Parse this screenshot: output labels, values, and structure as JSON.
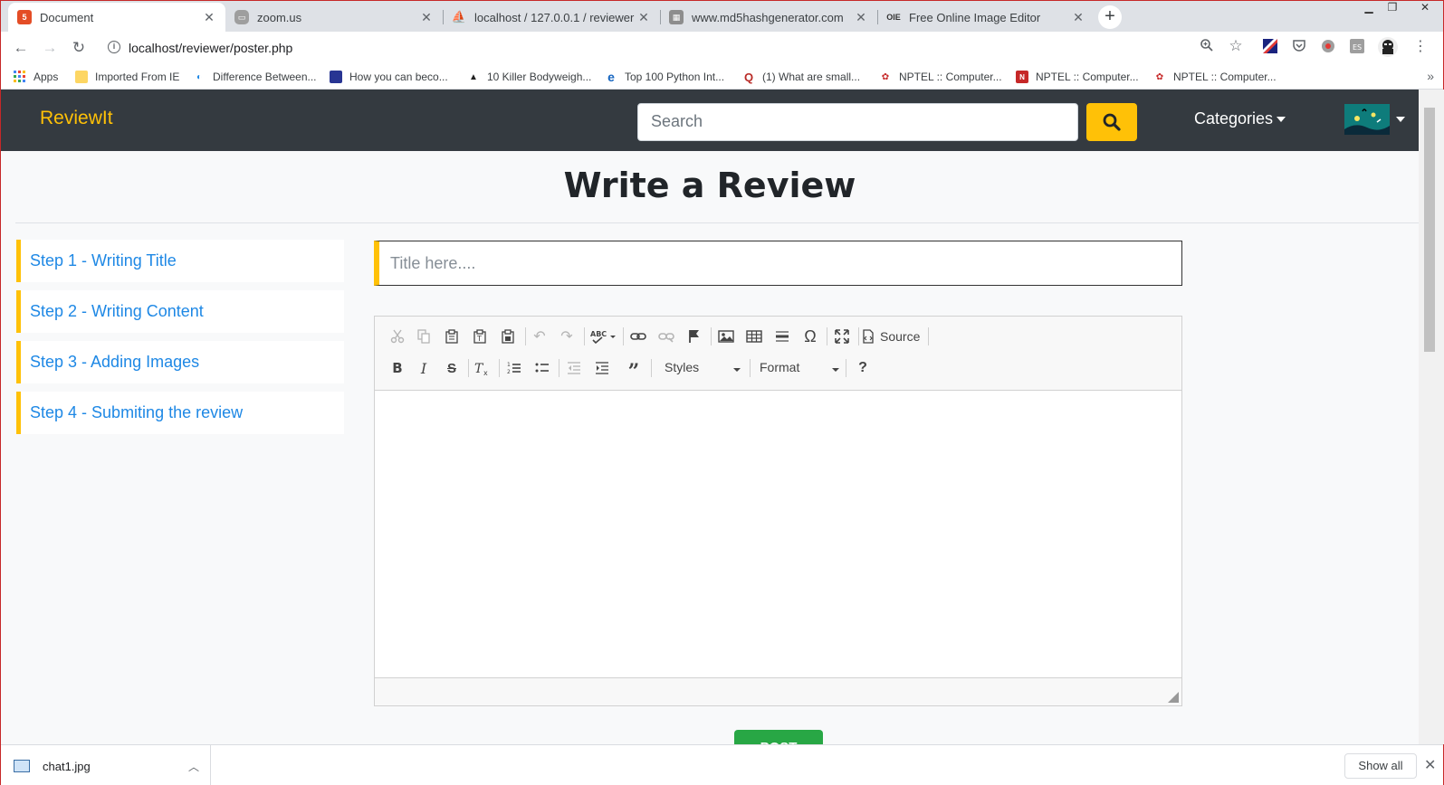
{
  "browser": {
    "tabs": [
      {
        "title": "Document",
        "icon": "html5-icon",
        "active": true
      },
      {
        "title": "zoom.us",
        "icon": "zoom-icon",
        "active": false
      },
      {
        "title": "localhost / 127.0.0.1 / reviewer / ",
        "icon": "phpmyadmin-icon",
        "active": false
      },
      {
        "title": "www.md5hashgenerator.com",
        "icon": "site-icon",
        "active": false
      },
      {
        "title": "Free Online Image Editor",
        "icon": "oie-icon",
        "active": false
      }
    ],
    "url": "localhost/reviewer/poster.php",
    "bookmarks": [
      {
        "label": "Apps",
        "icon": "apps-grid-icon"
      },
      {
        "label": "Imported From IE",
        "icon": "folder-icon"
      },
      {
        "label": "Difference Between...",
        "icon": "bookmark-icon"
      },
      {
        "label": "How you can beco...",
        "icon": "bookmark-icon"
      },
      {
        "label": "10 Killer Bodyweigh...",
        "icon": "bookmark-icon"
      },
      {
        "label": "Top 100 Python Int...",
        "icon": "bookmark-icon"
      },
      {
        "label": "(1) What are small...",
        "icon": "quora-icon"
      },
      {
        "label": "NPTEL :: Computer...",
        "icon": "nptel-icon"
      },
      {
        "label": "NPTEL :: Computer...",
        "icon": "nptel-icon"
      },
      {
        "label": "NPTEL :: Computer...",
        "icon": "nptel-icon"
      }
    ]
  },
  "site": {
    "brand": "ReviewIt",
    "search_placeholder": "Search",
    "categories_label": "Categories",
    "accent_color": "#ffc107",
    "navbar_color": "#343a40"
  },
  "page": {
    "title": "Write a Review",
    "steps": [
      "Step 1 - Writing Title",
      "Step 2 - Writing Content",
      "Step 3 - Adding Images",
      "Step 4 - Submiting the review"
    ],
    "title_placeholder": "Title here....",
    "editor": {
      "source_label": "Source",
      "styles_label": "Styles",
      "format_label": "Format"
    },
    "post_label": "POST"
  },
  "downloads": {
    "file": "chat1.jpg",
    "show_all": "Show all"
  }
}
